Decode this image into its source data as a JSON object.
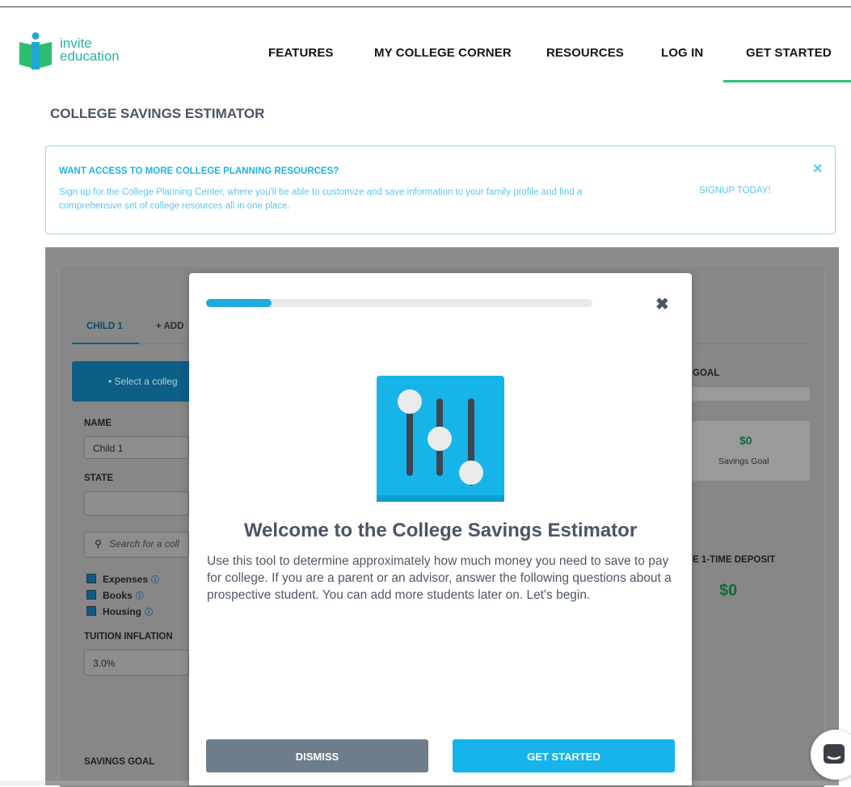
{
  "header": {
    "logo": {
      "line1": "invite",
      "line2": "education"
    },
    "nav": [
      {
        "label": "FEATURES"
      },
      {
        "label": "MY COLLEGE CORNER"
      },
      {
        "label": "RESOURCES"
      },
      {
        "label": "LOG IN"
      },
      {
        "label": "GET STARTED"
      }
    ],
    "active_nav": "GET STARTED"
  },
  "page": {
    "title": "COLLEGE SAVINGS ESTIMATOR"
  },
  "banner": {
    "title": "WANT ACCESS TO MORE COLLEGE PLANNING RESOURCES?",
    "text": "Sign up for the College Planning Center, where you'll be able to customize and save information to your family profile and find a comprehensive set of college resources all in one place.",
    "link": "SIGNUP TODAY!",
    "close_icon": "close-icon"
  },
  "background_app": {
    "tabs": [
      "CHILD 1",
      "+ ADD"
    ],
    "select_banner": "• Select a colleg",
    "name_label": "NAME",
    "name_value": "Child 1",
    "state_label": "STATE",
    "search_placeholder": "Search for a coll",
    "checkboxes": [
      "Expenses",
      "Books",
      "Housing"
    ],
    "inflation_label": "TUITION INFLATION",
    "inflation_value": "3.0%",
    "savings_goal_label": "SAVINGS GOAL",
    "goal_header": "GOAL",
    "goal_amount": "$0",
    "goal_caption": "Savings Goal",
    "deposit_label": "E 1-TIME DEPOSIT",
    "deposit_amount": "$0"
  },
  "modal": {
    "progress": 0.17,
    "title": "Welcome to the College Savings Estimator",
    "body": "Use this tool to determine approximately how much money you need to save to pay for college. If you are a parent or an advisor, answer the following questions about a prospective student. You can add more students later on. Let's begin.",
    "dismiss_label": "DISMISS",
    "start_label": "GET STARTED",
    "icon": "sliders-icon",
    "close_icon": "close-icon"
  },
  "colors": {
    "accent_blue": "#16b4ea",
    "nav_underline": "#2fc27a",
    "dismiss_gray": "#6e7d8b",
    "money_green": "#0f6b3a"
  }
}
